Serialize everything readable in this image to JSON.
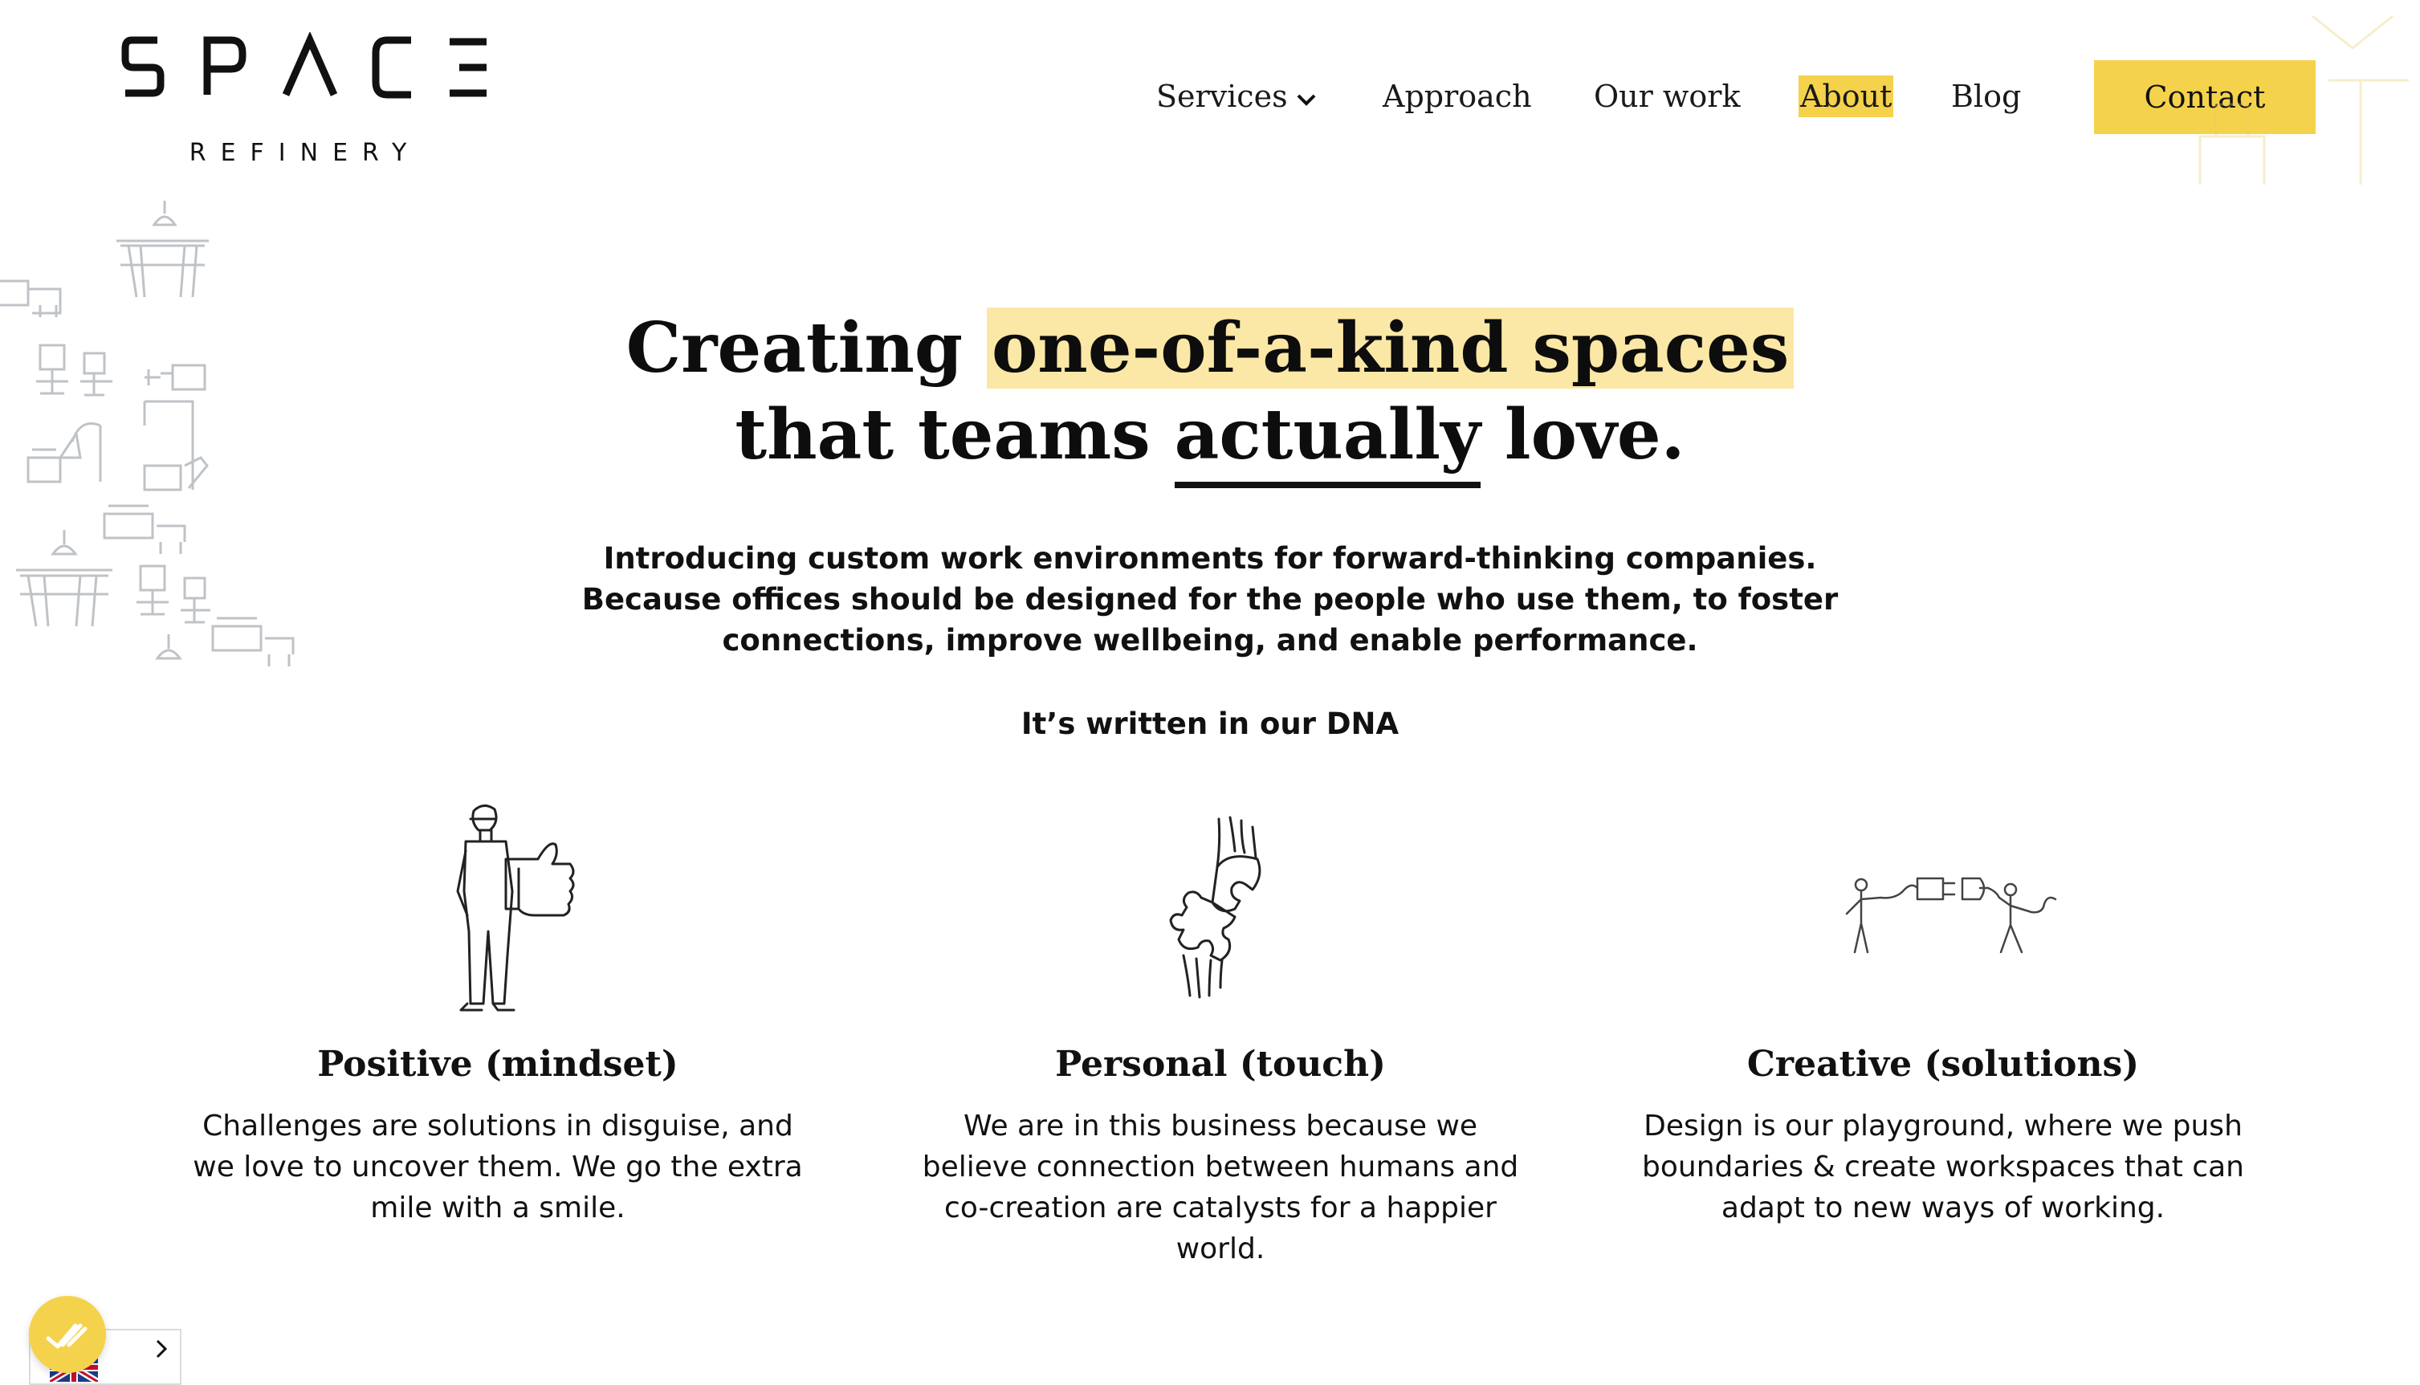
{
  "brand": {
    "wordmark": "SPACE",
    "subline": "REFINERY"
  },
  "nav": {
    "services": "Services",
    "approach": "Approach",
    "our_work": "Our work",
    "about": "About",
    "blog": "Blog",
    "contact": "Contact",
    "active": "About"
  },
  "hero": {
    "title_part1": "Creating ",
    "title_highlight": "one-of-a-kind spaces",
    "title_part2": "that teams ",
    "title_underline": "actually",
    "title_part3": " love.",
    "subtitle": "Introducing custom work environments for forward-thinking companies. Because offices should be designed for the people who use them, to foster connections, improve wellbeing, and enable performance.",
    "dna_label": "It’s written in our DNA"
  },
  "values": [
    {
      "title": "Positive (mindset)",
      "text": "Challenges are solutions in disguise, and we love to uncover them. We go the extra mile with a smile.",
      "icon": "thumbs-up-person-icon"
    },
    {
      "title": "Personal (touch)",
      "text": "We are in this business because we believe connection between humans and co-creation are catalysts for a happier world.",
      "icon": "puzzle-hands-icon"
    },
    {
      "title": "Creative (solutions)",
      "text": "Design is our playground, where we push boundaries & create workspaces that can adapt to new ways of working.",
      "icon": "plug-connection-icon"
    }
  ],
  "colors": {
    "accent": "#f5d24b",
    "highlight": "#fbe8a6",
    "text": "#111111",
    "line_art": "#bfc3c7"
  }
}
